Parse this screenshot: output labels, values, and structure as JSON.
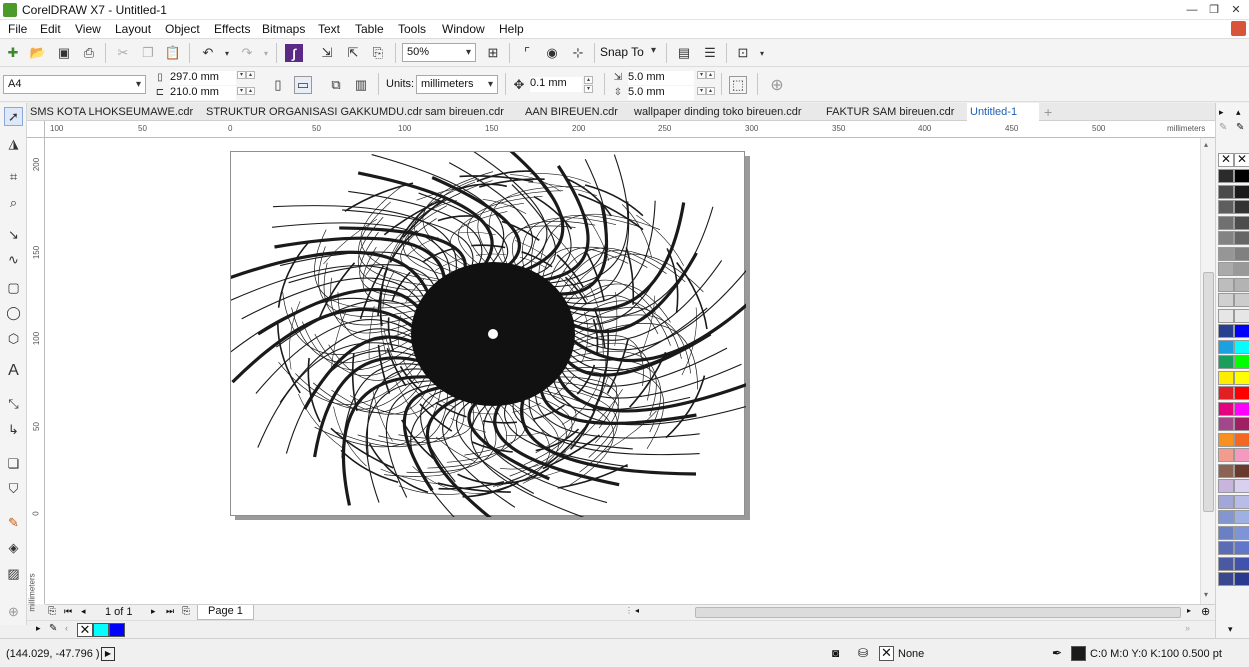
{
  "window": {
    "title": "CorelDRAW X7 - Untitled-1",
    "min": "—",
    "restore": "❐",
    "close": "✕"
  },
  "menu": [
    "File",
    "Edit",
    "View",
    "Layout",
    "Object",
    "Effects",
    "Bitmaps",
    "Text",
    "Table",
    "Tools",
    "Window",
    "Help"
  ],
  "toolbar": {
    "zoom": "50%",
    "snap_to": "Snap To"
  },
  "propbar": {
    "page_size": "A4",
    "width": "297.0 mm",
    "height": "210.0 mm",
    "units_label": "Units:",
    "units": "millimeters",
    "nudge": "0.1 mm",
    "dup_x": "5.0 mm",
    "dup_y": "5.0 mm"
  },
  "tabs": [
    "SMS KOTA LHOKSEUMAWE.cdr",
    "STRUKTUR ORGANISASI GAKKUMDU.cdr",
    "sam bireuen.cdr",
    "AAN BIREUEN.cdr",
    "wallpaper dinding toko bireuen.cdr",
    "FAKTUR SAM bireuen.cdr",
    "Untitled-1"
  ],
  "active_tab": "Untitled-1",
  "ruler": {
    "h_labels": [
      "100",
      "50",
      "0",
      "50",
      "100",
      "150",
      "200",
      "250",
      "300",
      "350",
      "400",
      "450",
      "500"
    ],
    "v_labels": [
      "200",
      "150",
      "100",
      "50",
      "0"
    ],
    "unit": "millimeters"
  },
  "pagenav": {
    "counter": "1 of 1",
    "page_tab": "Page 1"
  },
  "status": {
    "coords": "(144.029, -47.796 )",
    "fill": "None",
    "outline": "C:0 M:0 Y:0 K:100  0.500 pt"
  },
  "palette_colors": [
    [
      "#ffffff",
      "#ffffff"
    ],
    [
      "#2b2b2b",
      "#000000"
    ],
    [
      "#4a4a4a",
      "#1a1a1a"
    ],
    [
      "#5e5e5e",
      "#333333"
    ],
    [
      "#707070",
      "#4d4d4d"
    ],
    [
      "#838383",
      "#666666"
    ],
    [
      "#969696",
      "#808080"
    ],
    [
      "#aaaaaa",
      "#999999"
    ],
    [
      "#bdbdbd",
      "#b3b3b3"
    ],
    [
      "#d0d0d0",
      "#cccccc"
    ],
    [
      "#e6e6e6",
      "#e6e6e6"
    ],
    [
      "#263f8f",
      "#0000ff"
    ],
    [
      "#1ba1e2",
      "#00ffff"
    ],
    [
      "#1a9e5c",
      "#00ff00"
    ],
    [
      "#ffed00",
      "#ffff00"
    ],
    [
      "#e31e24",
      "#ff0000"
    ],
    [
      "#e5007e",
      "#ff00ff"
    ],
    [
      "#a1478a",
      "#9e1f63"
    ],
    [
      "#f7901e",
      "#f26722"
    ],
    [
      "#f29c8f",
      "#f49ac1"
    ],
    [
      "#8b6355",
      "#6b3a2f"
    ],
    [
      "#c7b5dd",
      "#d9d0f0"
    ],
    [
      "#a1a8d8",
      "#b8bde8"
    ],
    [
      "#8396cf",
      "#9fb0e3"
    ],
    [
      "#6a80c2",
      "#7d94d6"
    ],
    [
      "#5a6db4",
      "#6277c8"
    ],
    [
      "#4a5aa2",
      "#3f52ae"
    ],
    [
      "#3a4790",
      "#2a3990"
    ]
  ],
  "doc_palette": [
    "none",
    "#00ffff",
    "#0000ff"
  ],
  "outline_color": "#1a1a1a"
}
